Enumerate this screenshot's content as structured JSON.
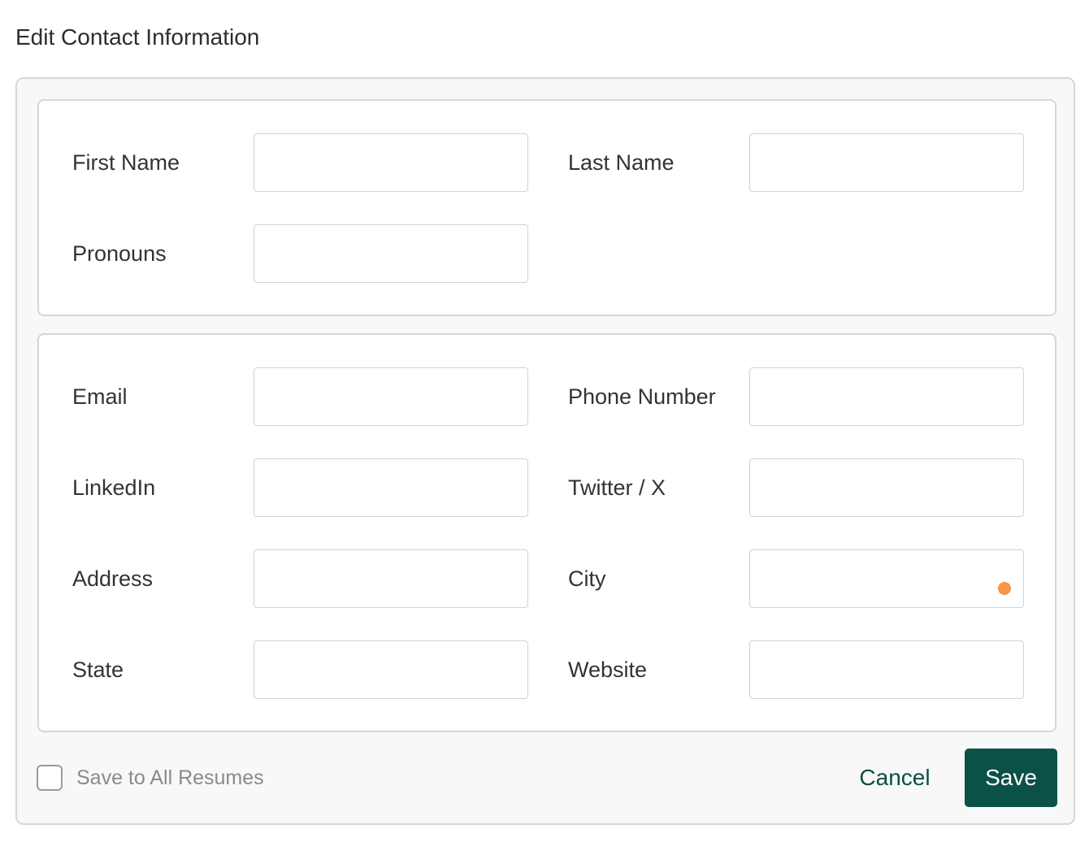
{
  "page": {
    "title": "Edit Contact Information"
  },
  "name_section": {
    "first_name": {
      "label": "First Name",
      "value": ""
    },
    "last_name": {
      "label": "Last Name",
      "value": ""
    },
    "pronouns": {
      "label": "Pronouns",
      "value": ""
    }
  },
  "contact_section": {
    "email": {
      "label": "Email",
      "value": ""
    },
    "phone_number": {
      "label": "Phone Number",
      "value": ""
    },
    "linkedin": {
      "label": "LinkedIn",
      "value": ""
    },
    "twitter": {
      "label": "Twitter / X",
      "value": ""
    },
    "address": {
      "label": "Address",
      "value": ""
    },
    "city": {
      "label": "City",
      "value": ""
    },
    "state": {
      "label": "State",
      "value": ""
    },
    "website": {
      "label": "Website",
      "value": ""
    }
  },
  "footer": {
    "save_all_label": "Save to All Resumes",
    "save_all_checked": false,
    "cancel_label": "Cancel",
    "save_label": "Save"
  },
  "colors": {
    "primary": "#0b5148",
    "autofill_indicator": "#f7954a",
    "border": "#d6d6d6"
  }
}
